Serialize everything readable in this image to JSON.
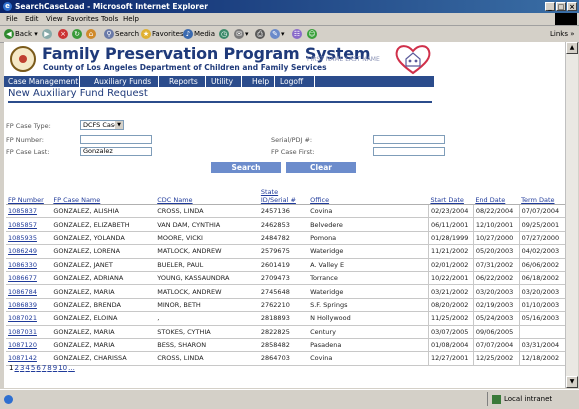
{
  "window": {
    "title": "SearchCaseLoad - Microsoft Internet Explorer"
  },
  "menu": [
    "File",
    "Edit",
    "View",
    "Favorites",
    "Tools",
    "Help"
  ],
  "toolbar": {
    "back": "Back",
    "search": "Search",
    "favorites": "Favorites",
    "media": "Media",
    "links": "Links"
  },
  "header": {
    "title": "Family Preservation Program System",
    "subtitle": "County of Los Angeles Department of Children and Family Services",
    "user": "FIRST NAME LAST NAME"
  },
  "nav": [
    "Case Management",
    "Auxiliary Funds",
    "Reports",
    "Utility",
    "Help",
    "Logoff"
  ],
  "page_title": "New Auxiliary Fund Request",
  "form": {
    "case_type_label": "FP Case Type:",
    "case_type_value": "DCFS Case",
    "fp_number_label": "FP Number:",
    "fp_number_value": "",
    "serial_label": "Serial/PDJ #:",
    "serial_value": "",
    "case_last_label": "FP Case Last:",
    "case_last_value": "Gonzalez",
    "case_first_label": "FP Case First:",
    "case_first_value": "",
    "search_label": "Search",
    "clear_label": "Clear"
  },
  "table": {
    "headers": [
      "FP Number",
      "FP Case Name",
      "CDC Name",
      "State ID/Serial #",
      "Office",
      "Start Date",
      "End Date",
      "Term Date"
    ],
    "rows": [
      [
        "1085837",
        "GONZALEZ, ALISHIA",
        "CROSS, LINDA",
        "2457136",
        "Covina",
        "02/23/2004",
        "08/22/2004",
        "07/07/2004"
      ],
      [
        "1085857",
        "GONZALEZ, ELIZABETH",
        "VAN DAM, CYNTHIA",
        "2462853",
        "Belvedere",
        "06/11/2001",
        "12/10/2001",
        "09/25/2001"
      ],
      [
        "1085935",
        "GONZALEZ, YOLANDA",
        "MOORE, VICKI",
        "2484782",
        "Pomona",
        "01/28/1999",
        "10/27/2000",
        "07/27/2000"
      ],
      [
        "1086249",
        "GONZALEZ, LORENA",
        "MATLOCK, ANDREW",
        "2579675",
        "Wateridge",
        "11/21/2002",
        "05/20/2003",
        "04/02/2003"
      ],
      [
        "1086330",
        "GONZALEZ, JANET",
        "BUELER, PAUL",
        "2601419",
        "A. Valley E",
        "02/01/2002",
        "07/31/2002",
        "06/06/2002"
      ],
      [
        "1086677",
        "GONZALEZ, ADRIANA",
        "YOUNG, KASSAUNDRA",
        "2709473",
        "Torrance",
        "10/22/2001",
        "06/22/2002",
        "06/18/2002"
      ],
      [
        "1086784",
        "GONZALEZ, MARIA",
        "MATLOCK, ANDREW",
        "2745648",
        "Wateridge",
        "03/21/2002",
        "03/20/2003",
        "03/20/2003"
      ],
      [
        "1086839",
        "GONZALEZ, BRENDA",
        "MINOR, BETH",
        "2762210",
        "S.F. Springs",
        "08/20/2002",
        "02/19/2003",
        "01/10/2003"
      ],
      [
        "1087021",
        "GONZALEZ, ELOINA",
        ",",
        "2818893",
        "N Hollywood",
        "11/25/2002",
        "05/24/2003",
        "05/16/2003"
      ],
      [
        "1087031",
        "GONZALEZ, MARIA",
        "STOKES, CYTHIA",
        "2822825",
        "Century",
        "03/07/2005",
        "09/06/2005",
        ""
      ],
      [
        "1087120",
        "GONZALEZ, MARIA",
        "BESS, SHARON",
        "2858482",
        "Pasadena",
        "01/08/2004",
        "07/07/2004",
        "03/31/2004"
      ],
      [
        "1087142",
        "GONZALEZ, CHARISSA",
        "CROSS, LINDA",
        "2864703",
        "Covina",
        "12/27/2001",
        "12/25/2002",
        "12/18/2002"
      ]
    ]
  },
  "pager": [
    "1",
    "2",
    "3",
    "4",
    "5",
    "6",
    "7",
    "8",
    "9",
    "10",
    "..."
  ],
  "status": {
    "zone": "Local intranet"
  },
  "colors": {
    "brand": "#1f3a7a",
    "nav": "#2b4c8c",
    "button": "#6c8ccc"
  }
}
